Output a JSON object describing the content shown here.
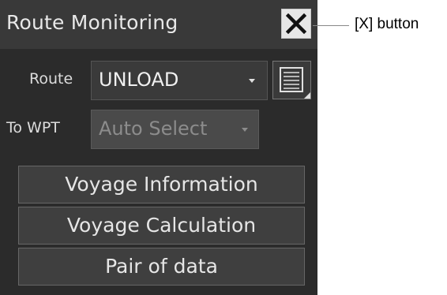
{
  "window": {
    "title": "Route Monitoring"
  },
  "route": {
    "label": "Route",
    "selected": "UNLOAD"
  },
  "to_wpt": {
    "label": "To WPT",
    "selected": "Auto Select"
  },
  "buttons": {
    "voyage_information": "Voyage Information",
    "voyage_calculation": "Voyage Calculation",
    "pair_of_data": "Pair of data"
  },
  "annotation": {
    "close_callout": "[X] button"
  },
  "icons": {
    "close": "close-icon",
    "route_list": "list-icon",
    "dropdown": "chevron-down-icon"
  },
  "colors": {
    "panel_bg": "#2b2b2b",
    "titlebar_bg": "#393939",
    "button_bg": "#3f3f3f",
    "text": "#e6e6e6",
    "disabled_text": "#8c8c8c"
  }
}
